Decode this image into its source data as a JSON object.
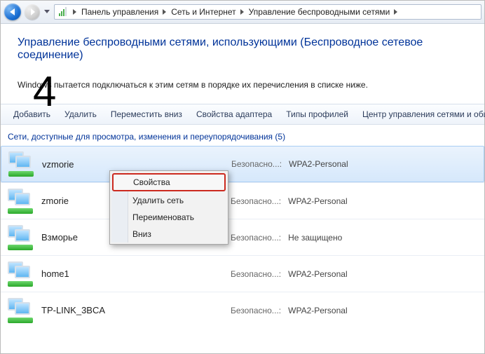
{
  "breadcrumb": {
    "seg1": "Панель управления",
    "seg2": "Сеть и Интернет",
    "seg3": "Управление беспроводными сетями"
  },
  "title": "Управление беспроводными сетями, использующими (Беспроводное сетевое соединение)",
  "description": "Windows пытается подключаться к этим сетям в порядке их перечисления в списке ниже.",
  "overlay": "4",
  "toolbar": {
    "add": "Добавить",
    "remove": "Удалить",
    "movedown": "Переместить вниз",
    "adapter": "Свойства адаптера",
    "profiles": "Типы профилей",
    "center": "Центр управления сетями и общим"
  },
  "section": {
    "label": "Сети, доступные для просмотра, изменения и переупорядочивания (5)"
  },
  "security_label": "Безопасно...:",
  "networks": [
    {
      "name": "vzmorie",
      "security": "WPA2-Personal",
      "selected": true
    },
    {
      "name": "zmorie",
      "security": "WPA2-Personal",
      "selected": false
    },
    {
      "name": "Взморье",
      "security": "Не защищено",
      "selected": false
    },
    {
      "name": "home1",
      "security": "WPA2-Personal",
      "selected": false
    },
    {
      "name": "TP-LINK_3BCA",
      "security": "WPA2-Personal",
      "selected": false
    }
  ],
  "context_menu": {
    "properties": "Свойства",
    "delete": "Удалить сеть",
    "rename": "Переименовать",
    "down": "Вниз"
  }
}
